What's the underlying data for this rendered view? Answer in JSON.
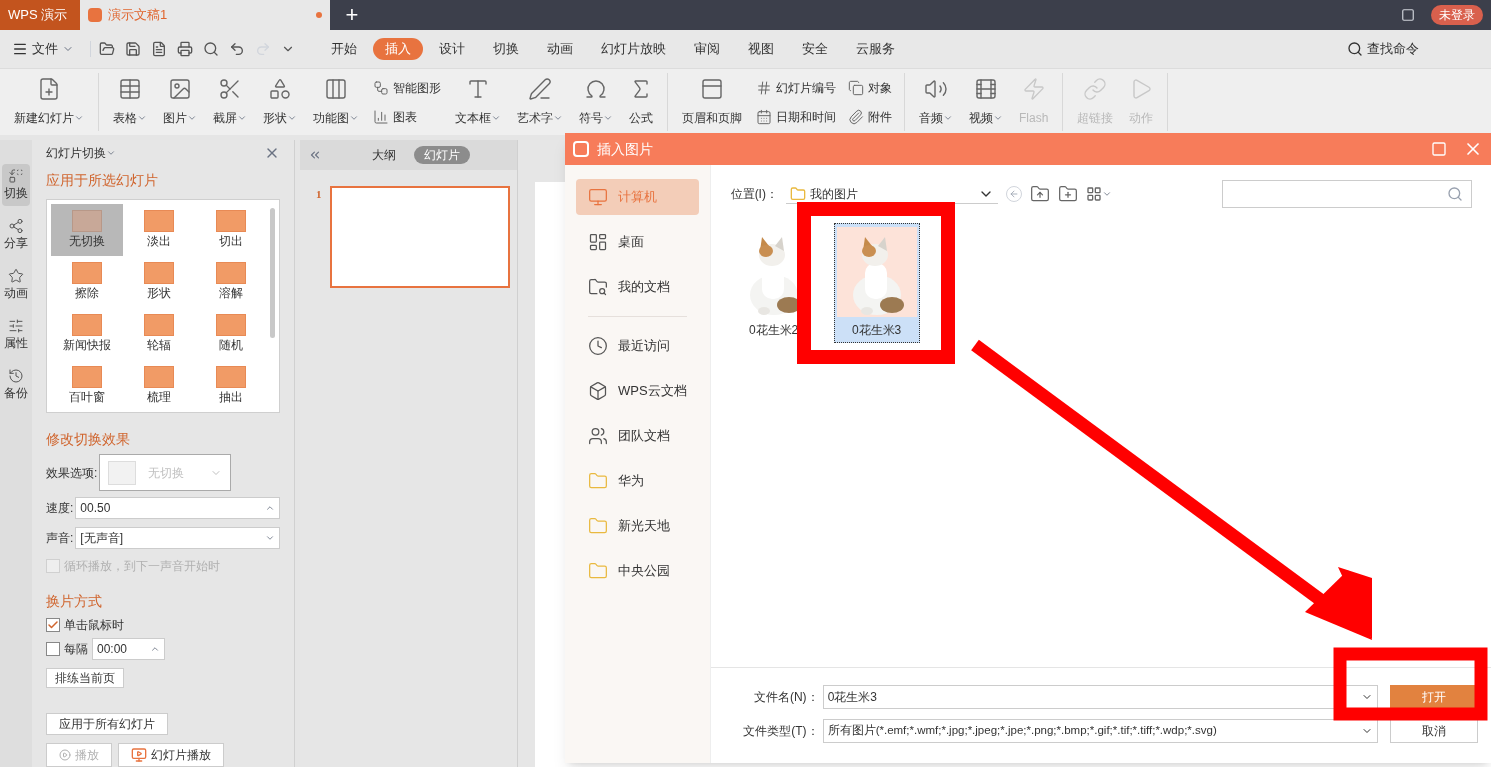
{
  "app_tab": {
    "label": "WPS 演示"
  },
  "doc_tab": {
    "label": "演示文稿1",
    "selected": true
  },
  "new_tab": "+",
  "login_button": "未登录",
  "menu": {
    "file": "文件",
    "tabs": [
      {
        "label": "开始",
        "selected": false
      },
      {
        "label": "插入",
        "selected": true
      },
      {
        "label": "设计",
        "selected": false
      },
      {
        "label": "切换",
        "selected": false
      },
      {
        "label": "动画",
        "selected": false
      },
      {
        "label": "幻灯片放映",
        "selected": false
      },
      {
        "label": "审阅",
        "selected": false
      },
      {
        "label": "视图",
        "selected": false
      },
      {
        "label": "安全",
        "selected": false
      },
      {
        "label": "云服务",
        "selected": false
      }
    ],
    "search": "查找命令"
  },
  "ribbon": [
    {
      "items": [
        {
          "kind": "large",
          "label": "新建幻灯片",
          "dropdown": true,
          "disabled": false
        }
      ]
    },
    {
      "items": [
        {
          "kind": "large",
          "label": "表格",
          "dropdown": true,
          "disabled": false
        },
        {
          "kind": "large",
          "label": "图片",
          "dropdown": true,
          "disabled": false
        },
        {
          "kind": "large",
          "label": "截屏",
          "dropdown": true,
          "disabled": false
        },
        {
          "kind": "large",
          "label": "形状",
          "dropdown": true,
          "disabled": false
        },
        {
          "kind": "large",
          "label": "功能图",
          "dropdown": true,
          "disabled": false
        },
        {
          "kind": "stack",
          "entries": [
            {
              "label": "智能图形"
            },
            {
              "label": "图表"
            }
          ]
        },
        {
          "kind": "large",
          "label": "文本框",
          "dropdown": true,
          "disabled": false
        },
        {
          "kind": "large",
          "label": "艺术字",
          "dropdown": true,
          "disabled": false
        },
        {
          "kind": "large",
          "label": "符号",
          "dropdown": true,
          "disabled": false
        },
        {
          "kind": "large",
          "label": "公式",
          "dropdown": false,
          "disabled": false
        }
      ]
    },
    {
      "items": [
        {
          "kind": "large",
          "label": "页眉和页脚",
          "dropdown": false,
          "disabled": false
        },
        {
          "kind": "stack",
          "entries": [
            {
              "label": "幻灯片编号"
            },
            {
              "label": "日期和时间"
            }
          ]
        },
        {
          "kind": "stack",
          "entries": [
            {
              "label": "对象"
            },
            {
              "label": "附件"
            }
          ]
        }
      ]
    },
    {
      "items": [
        {
          "kind": "large",
          "label": "音频",
          "dropdown": true,
          "disabled": false
        },
        {
          "kind": "large",
          "label": "视频",
          "dropdown": true,
          "disabled": false
        },
        {
          "kind": "large",
          "label": "Flash",
          "dropdown": false,
          "disabled": true
        }
      ]
    },
    {
      "items": [
        {
          "kind": "large",
          "label": "超链接",
          "dropdown": false,
          "disabled": true
        },
        {
          "kind": "large",
          "label": "动作",
          "dropdown": false,
          "disabled": true
        }
      ]
    }
  ],
  "side_rail": [
    {
      "label": "切换",
      "selected": true
    },
    {
      "label": "分享",
      "selected": false
    },
    {
      "label": "动画",
      "selected": false
    },
    {
      "label": "属性",
      "selected": false
    },
    {
      "label": "备份",
      "selected": false
    }
  ],
  "transition_panel": {
    "title": "幻灯片切换",
    "section_apply": "应用于所选幻灯片",
    "effects": [
      {
        "label": "无切换",
        "selected": true
      },
      {
        "label": "淡出",
        "selected": false
      },
      {
        "label": "切出",
        "selected": false
      },
      {
        "label": "擦除",
        "selected": false
      },
      {
        "label": "形状",
        "selected": false
      },
      {
        "label": "溶解",
        "selected": false
      },
      {
        "label": "新闻快报",
        "selected": false
      },
      {
        "label": "轮辐",
        "selected": false
      },
      {
        "label": "随机",
        "selected": false
      },
      {
        "label": "百叶窗",
        "selected": false
      },
      {
        "label": "梳理",
        "selected": false
      },
      {
        "label": "抽出",
        "selected": false
      }
    ],
    "section_modify": "修改切换效果",
    "option_label": "效果选项:",
    "option_value": "无切换",
    "speed_label": "速度:",
    "speed": "00.50",
    "sound_label": "声音:",
    "sound": "[无声音]",
    "loop": {
      "label": "循环播放，到下一声音开始时",
      "checked": false,
      "disabled": true
    },
    "section_advance": "换片方式",
    "on_click": {
      "label": "单击鼠标时",
      "checked": true
    },
    "every": {
      "label": "每隔",
      "checked": false,
      "value": "00:00"
    },
    "rehearse": "排练当前页",
    "apply_all": "应用于所有幻灯片",
    "play": {
      "label": "播放",
      "disabled": true
    },
    "slideshow": "幻灯片播放"
  },
  "slides_pane": {
    "tabs": [
      {
        "label": "大纲",
        "selected": false
      },
      {
        "label": "幻灯片",
        "selected": true
      }
    ],
    "slides": [
      {
        "number": "1",
        "selected": true
      }
    ]
  },
  "dialog": {
    "title": "插入图片",
    "nav_top": [
      {
        "label": "计算机",
        "selected": true
      },
      {
        "label": "桌面",
        "selected": false
      },
      {
        "label": "我的文档",
        "selected": false
      }
    ],
    "nav_bottom": [
      {
        "label": "最近访问",
        "selected": false
      },
      {
        "label": "WPS云文档",
        "selected": false
      },
      {
        "label": "团队文档",
        "selected": false
      },
      {
        "label": "华为",
        "selected": false
      },
      {
        "label": "新光天地",
        "selected": false
      },
      {
        "label": "中央公园",
        "selected": false
      }
    ],
    "location_label": "位置(I)：",
    "location": "我的图片",
    "files": [
      {
        "name": "0花生米2",
        "selected": false
      },
      {
        "name": "0花生米3",
        "selected": true
      }
    ],
    "filename_label": "文件名(N)：",
    "filename": "0花生米3",
    "filetype_label": "文件类型(T)：",
    "filetype": "所有图片(*.emf;*.wmf;*.jpg;*.jpeg;*.jpe;*.png;*.bmp;*.gif;*.tif;*.tiff;*.wdp;*.svg)",
    "open": "打开",
    "cancel": "取消"
  }
}
